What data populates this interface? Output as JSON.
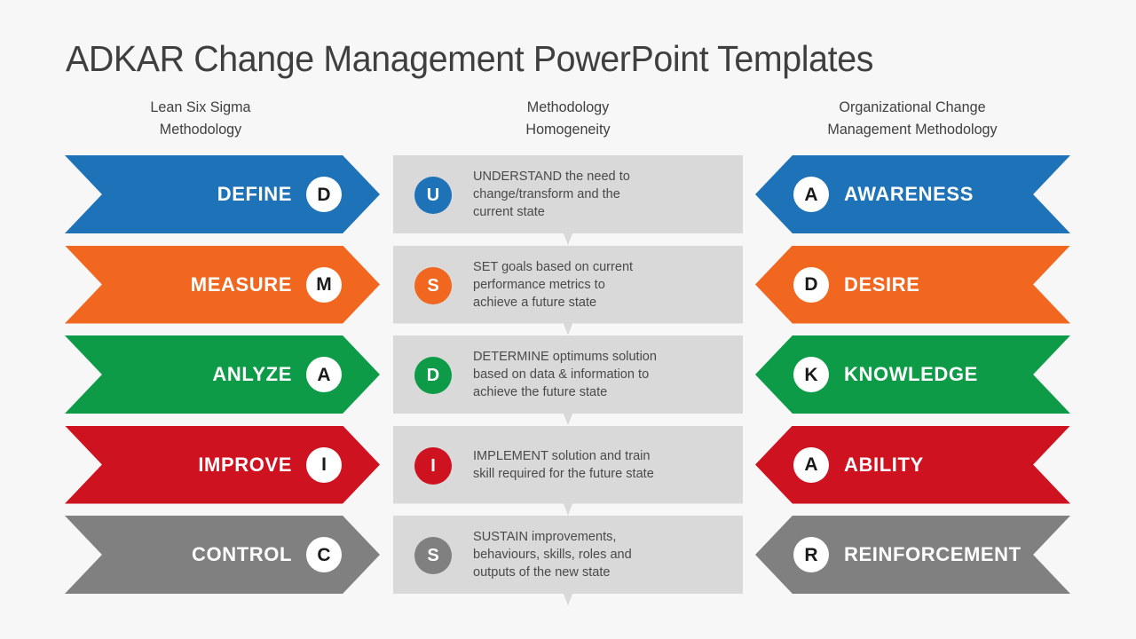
{
  "page": {
    "title": "ADKAR Change Management PowerPoint Templates",
    "background_color": "#f7f7f7"
  },
  "palette": {
    "blue": "#1d72b8",
    "orange": "#f1671f",
    "green": "#0d9b47",
    "red": "#ce1220",
    "gray": "#808080",
    "box_gray": "#d9d9d9",
    "text_dark": "#3f3f3f",
    "white": "#ffffff"
  },
  "columns": {
    "left": {
      "header_line1": "Lean Six Sigma",
      "header_line2": "Methodology"
    },
    "middle": {
      "header_line1": "Methodology",
      "header_line2": "Homogeneity"
    },
    "right": {
      "header_line1": "Organizational  Change",
      "header_line2": "Management  Methodology"
    }
  },
  "rows": [
    {
      "color": "#1d72b8",
      "left": {
        "label": "DEFINE",
        "badge": "D"
      },
      "middle": {
        "badge": "U",
        "line1": "UNDERSTAND the need to",
        "line2": "change/transform and the",
        "line3": "current state"
      },
      "right": {
        "label": "AWARENESS",
        "badge": "A"
      }
    },
    {
      "color": "#f1671f",
      "left": {
        "label": "MEASURE",
        "badge": "M"
      },
      "middle": {
        "badge": "S",
        "line1": "SET goals based on current",
        "line2": "performance metrics to",
        "line3": "achieve a  future state"
      },
      "right": {
        "label": "DESIRE",
        "badge": "D"
      }
    },
    {
      "color": "#0d9b47",
      "left": {
        "label": "ANLYZE",
        "badge": "A"
      },
      "middle": {
        "badge": "D",
        "line1": "DETERMINE optimums solution",
        "line2": "based on data & information to",
        "line3": "achieve the future state"
      },
      "right": {
        "label": "KNOWLEDGE",
        "badge": "K"
      }
    },
    {
      "color": "#ce1220",
      "left": {
        "label": "IMPROVE",
        "badge": "I"
      },
      "middle": {
        "badge": "I",
        "line1": "IMPLEMENT solution and train",
        "line2": "skill required for the future state",
        "line3": ""
      },
      "right": {
        "label": "ABILITY",
        "badge": "A"
      }
    },
    {
      "color": "#808080",
      "left": {
        "label": "CONTROL",
        "badge": "C"
      },
      "middle": {
        "badge": "S",
        "line1": "SUSTAIN improvements,",
        "line2": "behaviours, skills, roles and",
        "line3": "outputs of the new state"
      },
      "right": {
        "label": "REINFORCEMENT",
        "badge": "R"
      }
    }
  ]
}
